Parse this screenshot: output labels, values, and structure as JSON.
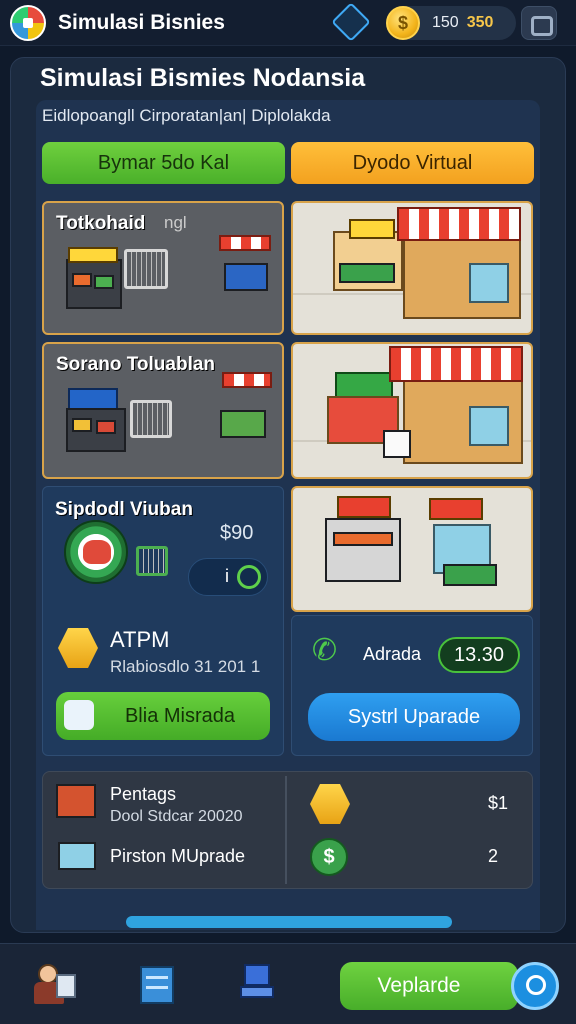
{
  "topbar": {
    "title": "Simulasi Bisnies",
    "coin_symbol": "$",
    "coins_a": "150",
    "coins_b": "350"
  },
  "panel": {
    "title": "Simulasi Bismies Nodansia",
    "subtitle": "Eidlopoangll Cirporatan|an| Diplolakda",
    "btn_left": "Bymar 5do Kal",
    "btn_right": "Dyodo Virtual"
  },
  "tiles": {
    "t1_label": "Totkohaid",
    "t1_label2": "ngl",
    "t2_label": "Sorano Toluablan",
    "t3_label": "Sipdodl Viuban",
    "t3_price": "$90",
    "t3_toggle": "i",
    "atpm_title": "ATPM",
    "atpm_sub": "Rlabiosdlo 31 201 1",
    "btn_misrada": "Blia Misrada",
    "adrada_label": "Adrada",
    "adrada_amount": "13.30",
    "btn_upgrade": "Systrl Uparade"
  },
  "bottom": {
    "pentags": "Pentags",
    "pentags_sub": "Dool Stdcar 20020",
    "piston": "Pirston MUprade",
    "val1": "$1",
    "val2": "2"
  },
  "nav": {
    "upgrade_label": "Veplarde"
  }
}
